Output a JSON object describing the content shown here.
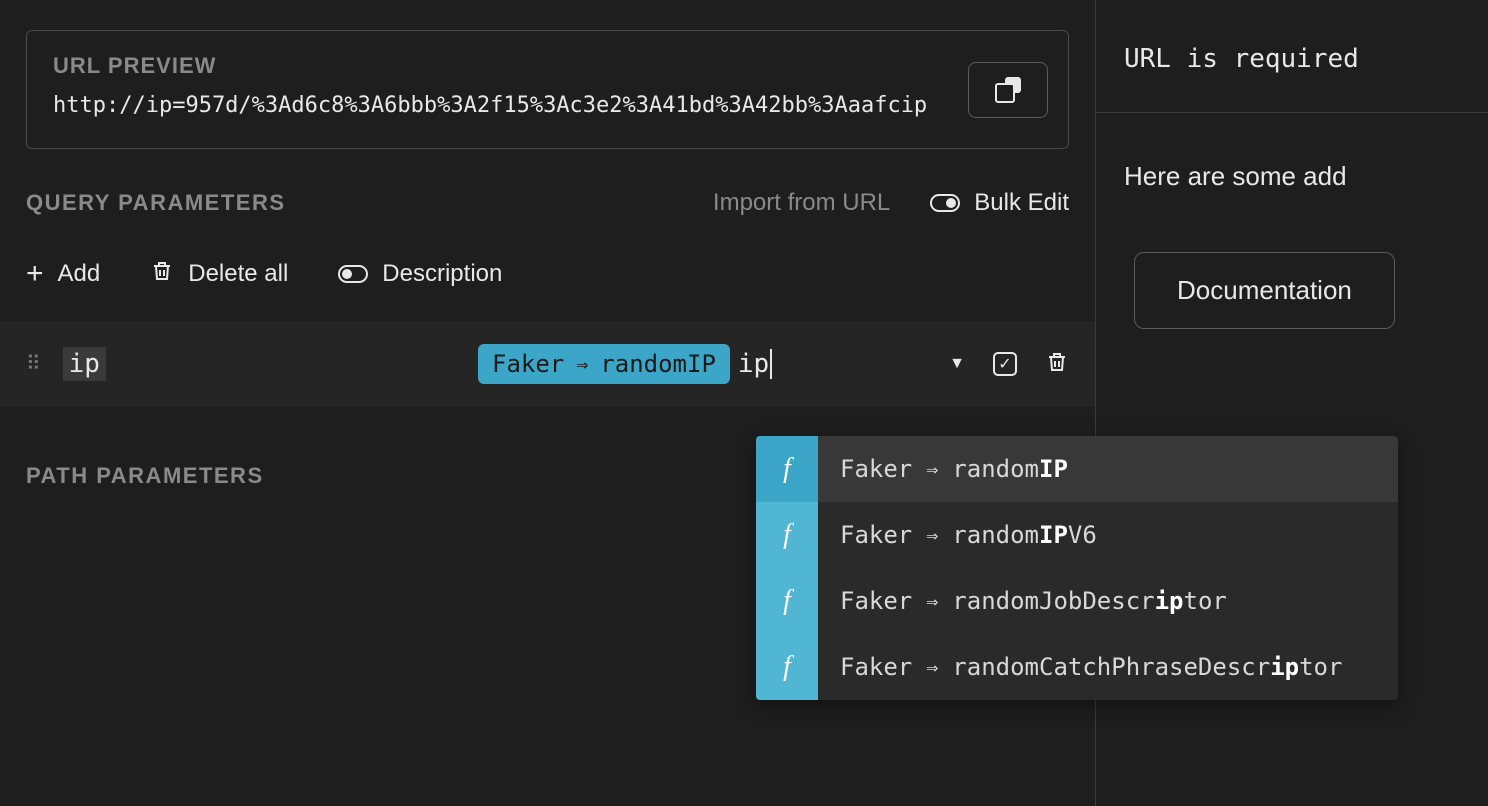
{
  "urlPreview": {
    "label": "URL PREVIEW",
    "value": "http://ip=957d/%3Ad6c8%3A6bbb%3A2f15%3Ac3e2%3A41bd%3A42bb%3Aaafcip"
  },
  "queryParams": {
    "title": "QUERY PARAMETERS",
    "importLabel": "Import from URL",
    "bulkEditLabel": "Bulk Edit",
    "addLabel": "Add",
    "deleteAllLabel": "Delete all",
    "descriptionLabel": "Description",
    "row": {
      "key": "ip",
      "pillPrefix": "Faker",
      "pillValue": "randomIP",
      "typed": "ip"
    }
  },
  "pathParams": {
    "title": "PATH PARAMETERS"
  },
  "autocomplete": {
    "provider": "Faker",
    "items": [
      {
        "prefix": "random",
        "bold": "IP",
        "suffix": "",
        "active": true
      },
      {
        "prefix": "random",
        "bold": "IP",
        "suffix": "V6",
        "active": false
      },
      {
        "prefix": "randomJobDescr",
        "bold": "ip",
        "suffix": "tor",
        "active": false
      },
      {
        "prefix": "randomCatchPhraseDescr",
        "bold": "ip",
        "suffix": "tor",
        "active": false
      }
    ]
  },
  "sidePanel": {
    "statusMessage": "URL is required",
    "hintText": "Here are some add",
    "docButton": "Documentation"
  }
}
